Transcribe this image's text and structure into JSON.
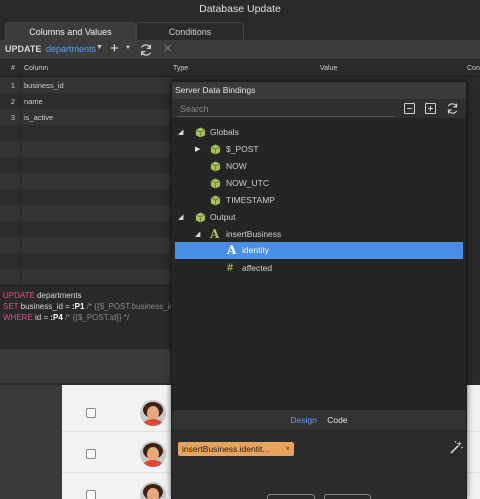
{
  "window": {
    "title": "Database Update"
  },
  "tabs": [
    {
      "label": "Columns and Values",
      "active": true
    },
    {
      "label": "Conditions",
      "active": false
    }
  ],
  "toolbar": {
    "keyword": "UPDATE",
    "table": "departments",
    "add_icon": "plus-icon",
    "refresh_icon": "refresh-icon",
    "close_icon": "close-icon"
  },
  "grid": {
    "headers": [
      "#",
      "Column",
      "Type",
      "Value",
      "Con"
    ],
    "rows": [
      {
        "num": "1",
        "column": "business_id"
      },
      {
        "num": "2",
        "column": "name"
      },
      {
        "num": "3",
        "column": "is_active"
      }
    ]
  },
  "sql": {
    "line1_kw": "UPDATE",
    "line1_rest": " departments",
    "line2_kw": "SET",
    "line2_mid": " business_id = ",
    "line2_param": ":P1",
    "line2_comment": " /* {{$_POST.business_id",
    "line3_kw": "WHERE",
    "line3_mid": " id = ",
    "line3_param": ":P4",
    "line3_comment": " /* {{$_POST.id}} */"
  },
  "popup": {
    "title": "Server Data Bindings",
    "search_placeholder": "Search",
    "tree": [
      {
        "label": "Globals",
        "icon": "cube-icon",
        "expanded": true
      },
      {
        "label": "$_POST",
        "icon": "cube-icon",
        "expanded": false
      },
      {
        "label": "NOW",
        "icon": "cube-icon"
      },
      {
        "label": "NOW_UTC",
        "icon": "cube-icon"
      },
      {
        "label": "TIMESTAMP",
        "icon": "cube-icon"
      },
      {
        "label": "Output",
        "icon": "cube-icon",
        "expanded": true
      },
      {
        "label": "insertBusiness",
        "icon": "text-a-icon",
        "expanded": true
      },
      {
        "label": "identity",
        "icon": "text-a-icon",
        "selected": true
      },
      {
        "label": "affected",
        "icon": "hash-icon"
      }
    ],
    "tab_design": "Design",
    "tab_code": "Code",
    "binding_pill": "insertBusiness.identit...",
    "pill_close": "×",
    "wand_icon": "magic-wand-icon"
  },
  "colors": {
    "accent": "#5aa0f5",
    "selection": "#4a8fe6",
    "sql_keyword": "#e24f8c",
    "icon_green": "#a7c05b",
    "pill": "#e8a35c"
  }
}
